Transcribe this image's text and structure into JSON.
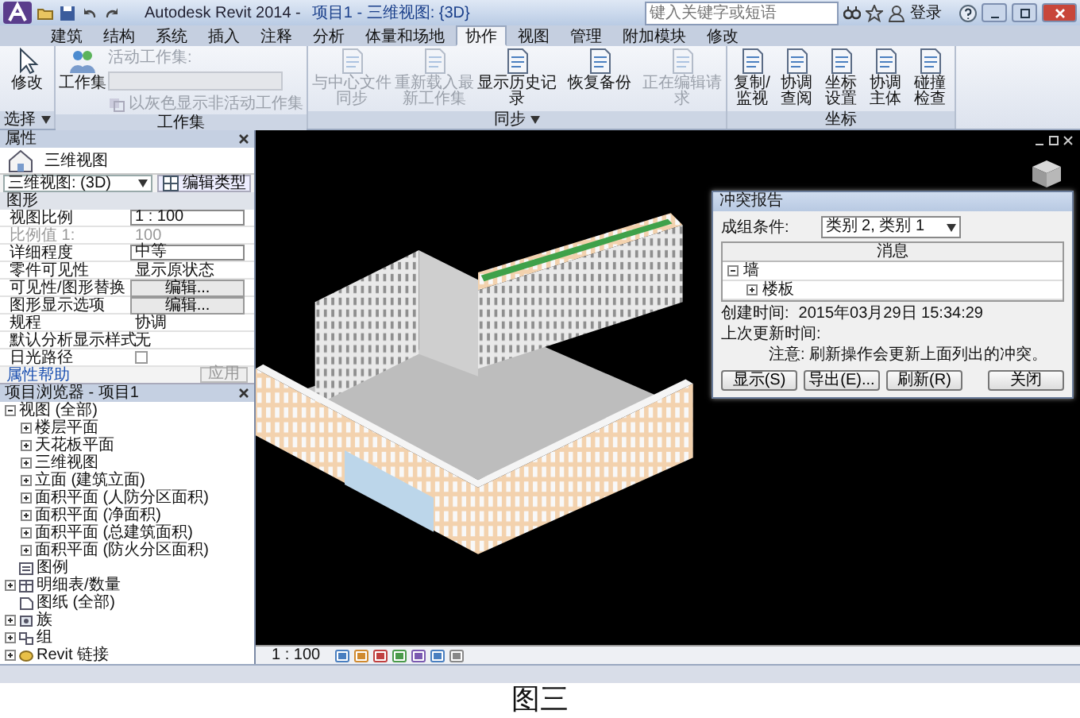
{
  "window": {
    "app_name": "Autodesk Revit 2014 -",
    "document": "项目1 - 三维视图: {3D}"
  },
  "search": {
    "placeholder": "键入关键字或短语"
  },
  "sign_in": "登录",
  "tabs": [
    {
      "label": "建筑",
      "selected": false
    },
    {
      "label": "结构",
      "selected": false
    },
    {
      "label": "系统",
      "selected": false
    },
    {
      "label": "插入",
      "selected": false
    },
    {
      "label": "注释",
      "selected": false
    },
    {
      "label": "分析",
      "selected": false
    },
    {
      "label": "体量和场地",
      "selected": false
    },
    {
      "label": "协作",
      "selected": true
    },
    {
      "label": "视图",
      "selected": false
    },
    {
      "label": "管理",
      "selected": false
    },
    {
      "label": "附加模块",
      "selected": false
    },
    {
      "label": "修改",
      "selected": false
    }
  ],
  "ribbon": [
    {
      "title": "选择",
      "menu": true,
      "items": [
        {
          "kind": "select",
          "label": "修改",
          "disabled": false
        }
      ]
    },
    {
      "title": "工作集",
      "menu": false,
      "items": [
        {
          "kind": "worksets",
          "label": "工作集",
          "disabled": false
        },
        {
          "kind": "combo",
          "label": "活动工作集:",
          "disabled": true
        },
        {
          "kind": "option",
          "label": "以灰色显示非活动工作集",
          "disabled": true
        }
      ]
    },
    {
      "title": "同步",
      "menu": true,
      "items": [
        {
          "kind": "large",
          "label": "与中心文件同步",
          "disabled": true
        },
        {
          "kind": "large",
          "label": "重新载入最新工作集",
          "disabled": true
        },
        {
          "kind": "large",
          "label": "显示历史记录",
          "disabled": false
        },
        {
          "kind": "large",
          "label": "恢复备份",
          "disabled": false
        },
        {
          "kind": "large",
          "label": "正在编辑请求",
          "disabled": true
        }
      ]
    },
    {
      "title": "坐标",
      "menu": false,
      "items": [
        {
          "kind": "small",
          "label": "复制/监视",
          "disabled": false
        },
        {
          "kind": "small",
          "label": "协调查阅",
          "disabled": false
        },
        {
          "kind": "small",
          "label": "坐标设置",
          "disabled": false
        },
        {
          "kind": "small",
          "label": "协调主体",
          "disabled": false
        },
        {
          "kind": "small",
          "label": "碰撞检查",
          "disabled": false
        }
      ]
    }
  ],
  "properties": {
    "title": "属性",
    "type_name": "三维视图",
    "type_selector": "三维视图: (3D)",
    "edit_type": "编辑类型",
    "section": "图形",
    "rows": [
      {
        "label": "视图比例",
        "kind": "field",
        "value": "1 : 100",
        "disabled": false
      },
      {
        "label": "比例值 1:",
        "kind": "text",
        "value": "100",
        "disabled": true
      },
      {
        "label": "详细程度",
        "kind": "field",
        "value": "中等",
        "disabled": false
      },
      {
        "label": "零件可见性",
        "kind": "text",
        "value": "显示原状态",
        "disabled": false
      },
      {
        "label": "可见性/图形替换",
        "kind": "button",
        "value": "编辑...",
        "disabled": false
      },
      {
        "label": "图形显示选项",
        "kind": "button",
        "value": "编辑...",
        "disabled": false
      },
      {
        "label": "规程",
        "kind": "text",
        "value": "协调",
        "disabled": false
      },
      {
        "label": "默认分析显示样式",
        "kind": "text",
        "value": "无",
        "disabled": false
      },
      {
        "label": "日光路径",
        "kind": "check",
        "checked": false,
        "disabled": false
      }
    ],
    "help": "属性帮助",
    "apply": "应用"
  },
  "project_browser": {
    "title": "项目浏览器 - 项目1",
    "items": [
      {
        "label": "视图 (全部)",
        "expanded": true,
        "children": [
          {
            "label": "楼层平面",
            "expanded": false
          },
          {
            "label": "天花板平面",
            "expanded": false
          },
          {
            "label": "三维视图",
            "expanded": false
          },
          {
            "label": "立面 (建筑立面)",
            "expanded": false
          },
          {
            "label": "面积平面 (人防分区面积)",
            "expanded": false
          },
          {
            "label": "面积平面 (净面积)",
            "expanded": false
          },
          {
            "label": "面积平面 (总建筑面积)",
            "expanded": false
          },
          {
            "label": "面积平面 (防火分区面积)",
            "expanded": false
          }
        ]
      },
      {
        "kind": "legend",
        "label": "图例"
      },
      {
        "kind": "schedule",
        "label": "明细表/数量",
        "expanded": false
      },
      {
        "kind": "sheet",
        "label": "图纸 (全部)"
      },
      {
        "kind": "family",
        "label": "族",
        "expanded": false
      },
      {
        "kind": "group",
        "label": "组",
        "expanded": false
      },
      {
        "kind": "link",
        "label": "Revit 链接",
        "expanded": false
      }
    ]
  },
  "view_control": {
    "scale": "1 : 100"
  },
  "dialog": {
    "title": "冲突报告",
    "group_label": "成组条件:",
    "group_value": "类别 2, 类别 1",
    "column": "消息",
    "items": [
      {
        "label": "墙",
        "expanded": true,
        "children": [
          {
            "label": "楼板",
            "expanded": false
          }
        ]
      }
    ],
    "created_label": "创建时间:",
    "created_value": "2015年03月29日 15:34:29",
    "updated_label": "上次更新时间:",
    "note": "注意: 刷新操作会更新上面列出的冲突。",
    "buttons": [
      "显示(S)",
      "导出(E)...",
      "刷新(R)",
      "关闭"
    ]
  },
  "caption": "图三"
}
